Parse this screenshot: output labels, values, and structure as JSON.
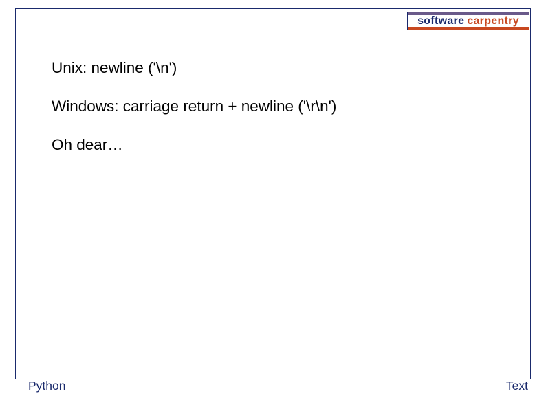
{
  "logo": {
    "part1": "software",
    "part2": "carpentry"
  },
  "content": {
    "lines": [
      "Unix: newline ('\\n')",
      "Windows: carriage return + newline ('\\r\\n')",
      "Oh dear…"
    ]
  },
  "footer": {
    "left": "Python",
    "right": "Text"
  }
}
